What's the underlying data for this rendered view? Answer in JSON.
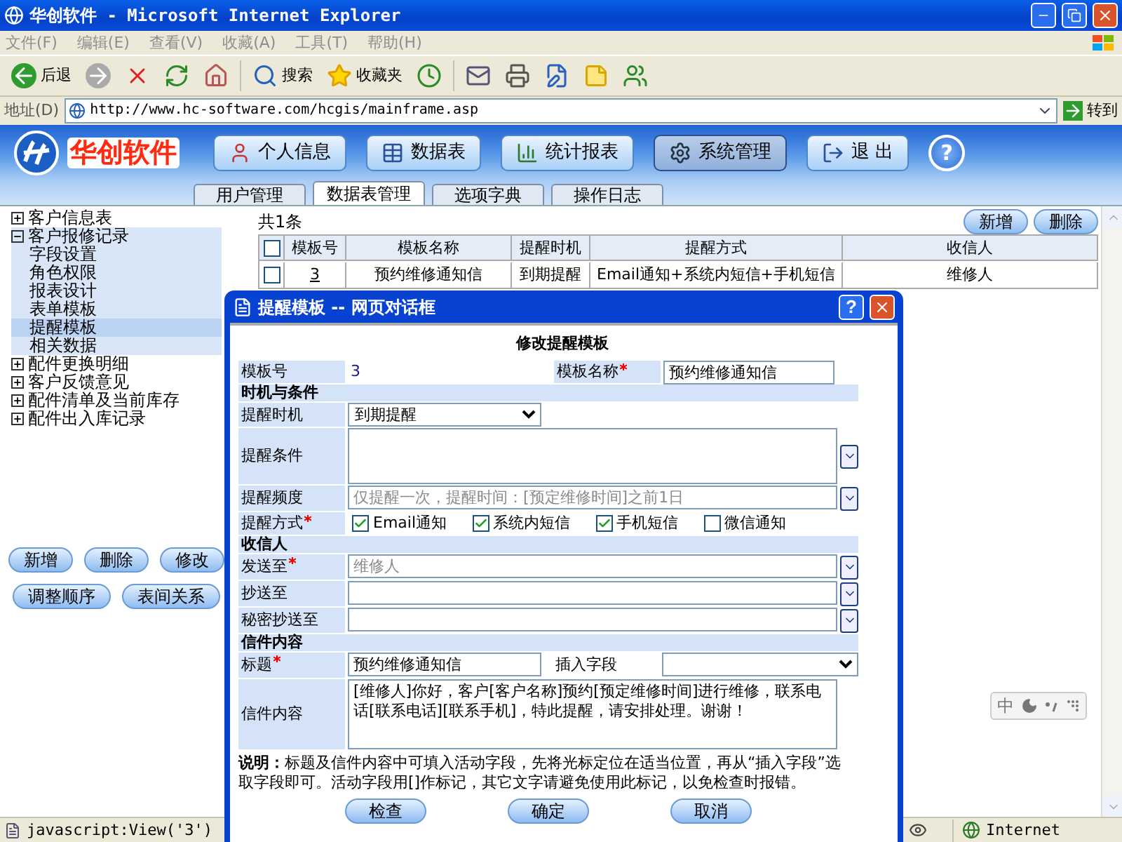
{
  "window": {
    "title": "华创软件 - Microsoft Internet Explorer"
  },
  "menu": [
    "文件(F)",
    "编辑(E)",
    "查看(V)",
    "收藏(A)",
    "工具(T)",
    "帮助(H)"
  ],
  "toolbar": {
    "back": "后退",
    "search": "搜索",
    "favorites": "收藏夹"
  },
  "address": {
    "label": "地址(D)",
    "url": "http://www.hc-software.com/hcgis/mainframe.asp",
    "go": "转到"
  },
  "app": {
    "logo": "华创软件",
    "help": "?",
    "nav": [
      {
        "kind": "user",
        "label": "个人信息",
        "selected": false
      },
      {
        "kind": "table",
        "label": "数据表",
        "selected": false
      },
      {
        "kind": "chart",
        "label": "统计报表",
        "selected": false
      },
      {
        "kind": "settings",
        "label": "系统管理",
        "selected": true
      },
      {
        "kind": "exit",
        "label": "退 出",
        "selected": false
      }
    ]
  },
  "tabs": [
    {
      "label": "用户管理",
      "selected": false
    },
    {
      "label": "数据表管理",
      "selected": true
    },
    {
      "label": "选项字典",
      "selected": false
    },
    {
      "label": "操作日志",
      "selected": false
    }
  ],
  "sidebar": {
    "tree": [
      {
        "label": "客户信息表",
        "expanded": false
      },
      {
        "label": "客户报修记录",
        "expanded": true,
        "children": [
          {
            "label": "字段设置",
            "selected": false
          },
          {
            "label": "角色权限",
            "selected": false
          },
          {
            "label": "报表设计",
            "selected": false
          },
          {
            "label": "表单模板",
            "selected": false
          },
          {
            "label": "提醒模板",
            "selected": true
          },
          {
            "label": "相关数据",
            "selected": false
          }
        ]
      },
      {
        "label": "配件更换明细",
        "expanded": false
      },
      {
        "label": "客户反馈意见",
        "expanded": false
      },
      {
        "label": "配件清单及当前库存",
        "expanded": false
      },
      {
        "label": "配件出入库记录",
        "expanded": false
      }
    ],
    "buttons": [
      [
        "新增",
        "删除",
        "修改"
      ],
      [
        "调整顺序",
        "表间关系"
      ]
    ]
  },
  "list": {
    "count": "共1条",
    "buttons": [
      "新增",
      "删除"
    ],
    "all_checked": false,
    "columns": [
      "模板号",
      "模板名称",
      "提醒时机",
      "提醒方式",
      "收信人"
    ],
    "rows": [
      {
        "checked": false,
        "cells": [
          "3",
          "预约维修通知信",
          "到期提醒",
          "Email通知+系统内短信+手机短信",
          "维修人"
        ]
      }
    ]
  },
  "dialog": {
    "title": "提醒模板 -- 网页对话框",
    "help": "?",
    "heading": "修改提醒模板",
    "rows": [
      {
        "kind": "pair",
        "label": "模板号",
        "value": "3",
        "label2": "模板名称",
        "required2": true,
        "value2": "预约维修通知信"
      },
      {
        "kind": "section",
        "label": "时机与条件"
      },
      {
        "kind": "select",
        "label": "提醒时机",
        "value": "到期提醒"
      },
      {
        "kind": "textarea",
        "label": "提醒条件",
        "picker": true
      },
      {
        "kind": "text",
        "label": "提醒频度",
        "value": "仅提醒一次，提醒时间：[预定维修时间]之前1日",
        "disabled": true,
        "picker": true
      },
      {
        "kind": "checks",
        "label": "提醒方式",
        "required": true,
        "options": [
          {
            "label": "Email通知",
            "checked": true
          },
          {
            "label": "系统内短信",
            "checked": true
          },
          {
            "label": "手机短信",
            "checked": true
          },
          {
            "label": "微信通知",
            "checked": false
          }
        ]
      },
      {
        "kind": "section",
        "label": "收信人"
      },
      {
        "kind": "text",
        "label": "发送至",
        "required": true,
        "value": "维修人",
        "disabled": true,
        "picker": true
      },
      {
        "kind": "text",
        "label": "抄送至",
        "picker": true
      },
      {
        "kind": "text",
        "label": "秘密抄送至",
        "picker": true
      },
      {
        "kind": "section",
        "label": "信件内容"
      },
      {
        "kind": "subject",
        "label": "标题",
        "required": true,
        "value": "预约维修通知信",
        "label2": "插入字段"
      },
      {
        "kind": "textarea",
        "label": "信件内容",
        "value": "[维修人]你好，客户[客户名称]预约[预定维修时间]进行维修，联系电话[联系电话][联系手机]，特此提醒，请安排处理。谢谢！"
      }
    ],
    "note": "**说明：**标题及信件内容中可填入活动字段，先将光标定位在适当位置，再从“插入字段”选取字段即可。活动字段用[]作标记，其它文字请避免使用此标记，以免检查时报错。",
    "buttons": [
      "检查",
      "确定",
      "取消"
    ]
  },
  "ime": {
    "mode": "中"
  },
  "status_bar": {
    "text": "javascript:View('3')",
    "zone": "Internet"
  }
}
